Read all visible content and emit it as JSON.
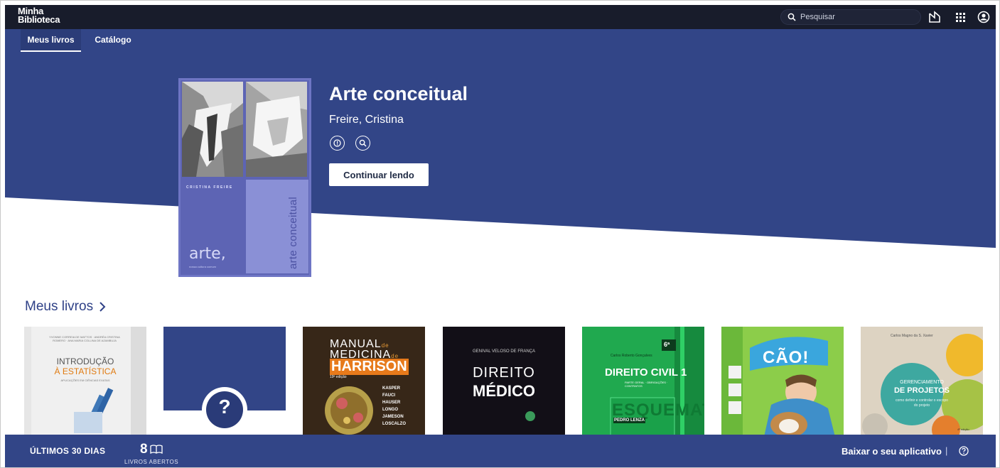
{
  "app": {
    "logo_line1": "Minha",
    "logo_line2": "Biblioteca",
    "search_placeholder": "Pesquisar"
  },
  "icons": {
    "search": "search-icon",
    "reader": "reader-icon",
    "apps": "apps-grid-icon",
    "account": "account-icon",
    "info": "info-icon",
    "search_in_book": "search-icon",
    "chevron": "chevron-right-icon",
    "book": "open-book-icon",
    "help": "help-icon"
  },
  "nav": {
    "tabs": [
      {
        "label": "Meus livros",
        "active": true
      },
      {
        "label": "Catálogo",
        "active": false
      }
    ]
  },
  "featured": {
    "title": "Arte conceitual",
    "author": "Freire, Cristina",
    "cover_author": "CRISTINA FREIRE",
    "cover_title_vertical": "arte conceitual",
    "cover_series": "arte,",
    "cover_series_sub": "nossa cultura comum",
    "continue_label": "Continuar lendo"
  },
  "section": {
    "title": "Meus livros"
  },
  "books": [
    {
      "top_text": "YVONNE CORREIA DE MATTOS · ANDRÉA CRISTINA ROMERO · ANA MARIA COLLINA DE AZAMBUJA",
      "title_line1": "INTRODUÇÃO",
      "title_line2": "À ESTATÍSTICA",
      "subtitle": "APLICAÇÕES EM CIÊNCIAS EXATAS"
    },
    {
      "placeholder": "?"
    },
    {
      "title_line1": "MANUAL",
      "title_line1_small": "de",
      "title_line2": "MEDICINA",
      "title_line2_small": "de",
      "title_line3": "HARRISON",
      "edition": "19ª edição",
      "authors": [
        "KASPER",
        "FAUCI",
        "HAUSER",
        "LONGO",
        "JAMESON",
        "LOSCALZO"
      ]
    },
    {
      "author": "GENIVAL VELOSO DE FRANÇA",
      "title_line1": "DIREITO",
      "title_line2": "MÉDICO"
    },
    {
      "badge": "6ª",
      "author": "Carlos Roberto Gonçalves",
      "title": "DIREITO CIVIL 1",
      "subtitle": "PARTE GERAL · OBRIGAÇÕES · CONTRATOS",
      "series": "ESQUEMATIZADO",
      "coordinator": "PEDRO LENZA"
    },
    {
      "title": "CÃO!"
    },
    {
      "author": "Carlos Magno da S. Xavier",
      "title_small": "GERENCIAMENTO",
      "title_big": "DE PROJETOS",
      "subtitle": "como definir e controlar o escopo do projeto",
      "edition": "4ª edição"
    }
  ],
  "stats": {
    "period": "ÚLTIMOS 30 DIAS",
    "count": "8",
    "count_label": "LIVROS ABERTOS"
  },
  "footer": {
    "app_link": "Baixar o seu aplicativo",
    "separator": "|"
  },
  "colors": {
    "topbar": "#181c2b",
    "primary": "#324587",
    "featured_cover": "#5d64b4"
  }
}
